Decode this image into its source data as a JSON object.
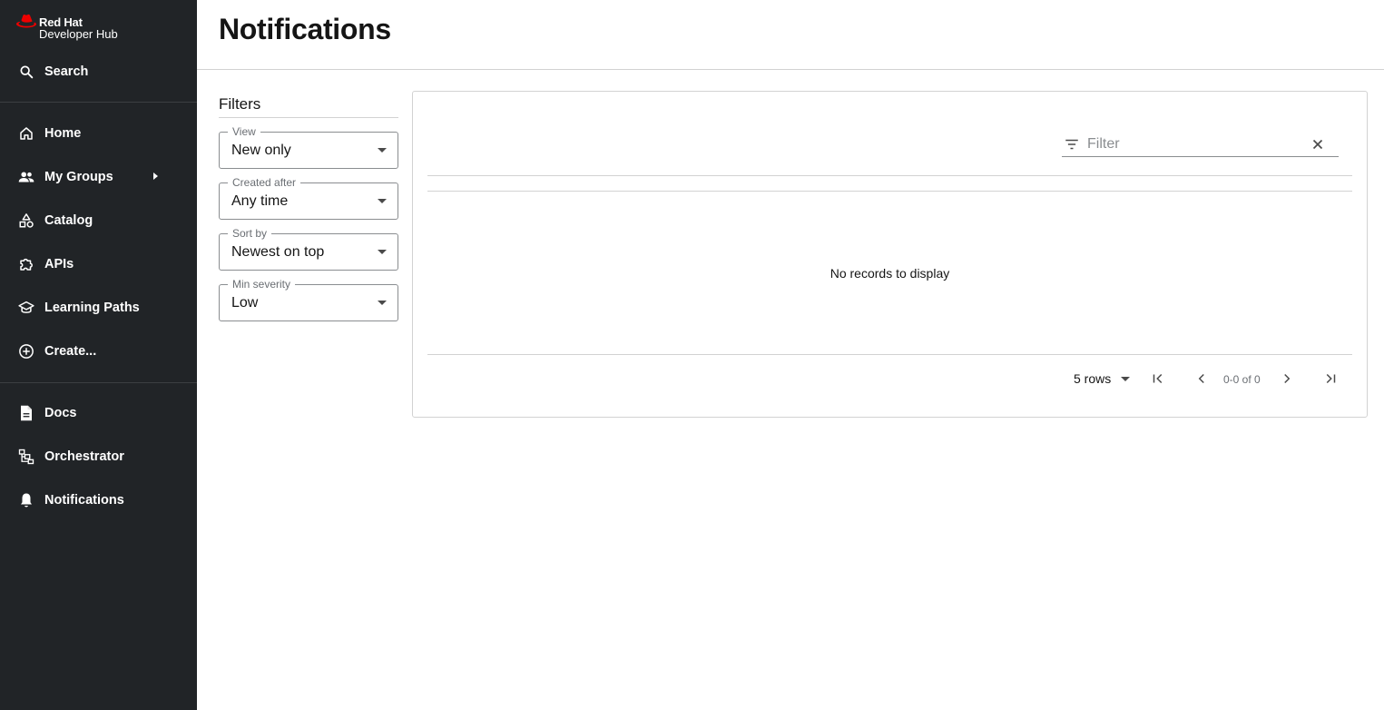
{
  "brand": {
    "line1": "Red Hat",
    "line2": "Developer Hub"
  },
  "sidebar": {
    "search_label": "Search",
    "items": [
      {
        "label": "Home",
        "icon": "home-icon"
      },
      {
        "label": "My Groups",
        "icon": "people-icon"
      },
      {
        "label": "Catalog",
        "icon": "catalog-icon"
      },
      {
        "label": "APIs",
        "icon": "puzzle-icon"
      },
      {
        "label": "Learning Paths",
        "icon": "school-icon"
      },
      {
        "label": "Create...",
        "icon": "add-circle-icon"
      }
    ],
    "bottom_items": [
      {
        "label": "Docs",
        "icon": "document-icon"
      },
      {
        "label": "Orchestrator",
        "icon": "orchestrator-icon"
      },
      {
        "label": "Notifications",
        "icon": "bell-icon"
      }
    ]
  },
  "header": {
    "title": "Notifications"
  },
  "filters": {
    "title": "Filters",
    "view": {
      "label": "View",
      "value": "New only"
    },
    "created_after": {
      "label": "Created after",
      "value": "Any time"
    },
    "sort_by": {
      "label": "Sort by",
      "value": "Newest on top"
    },
    "min_severity": {
      "label": "Min severity",
      "value": "Low"
    }
  },
  "table": {
    "filter_placeholder": "Filter",
    "empty_message": "No records to display",
    "rows_per_page": "5 rows",
    "page_info": "0-0 of 0"
  },
  "colors": {
    "sidebar_bg": "#212427",
    "brand_red": "#ee0000"
  }
}
